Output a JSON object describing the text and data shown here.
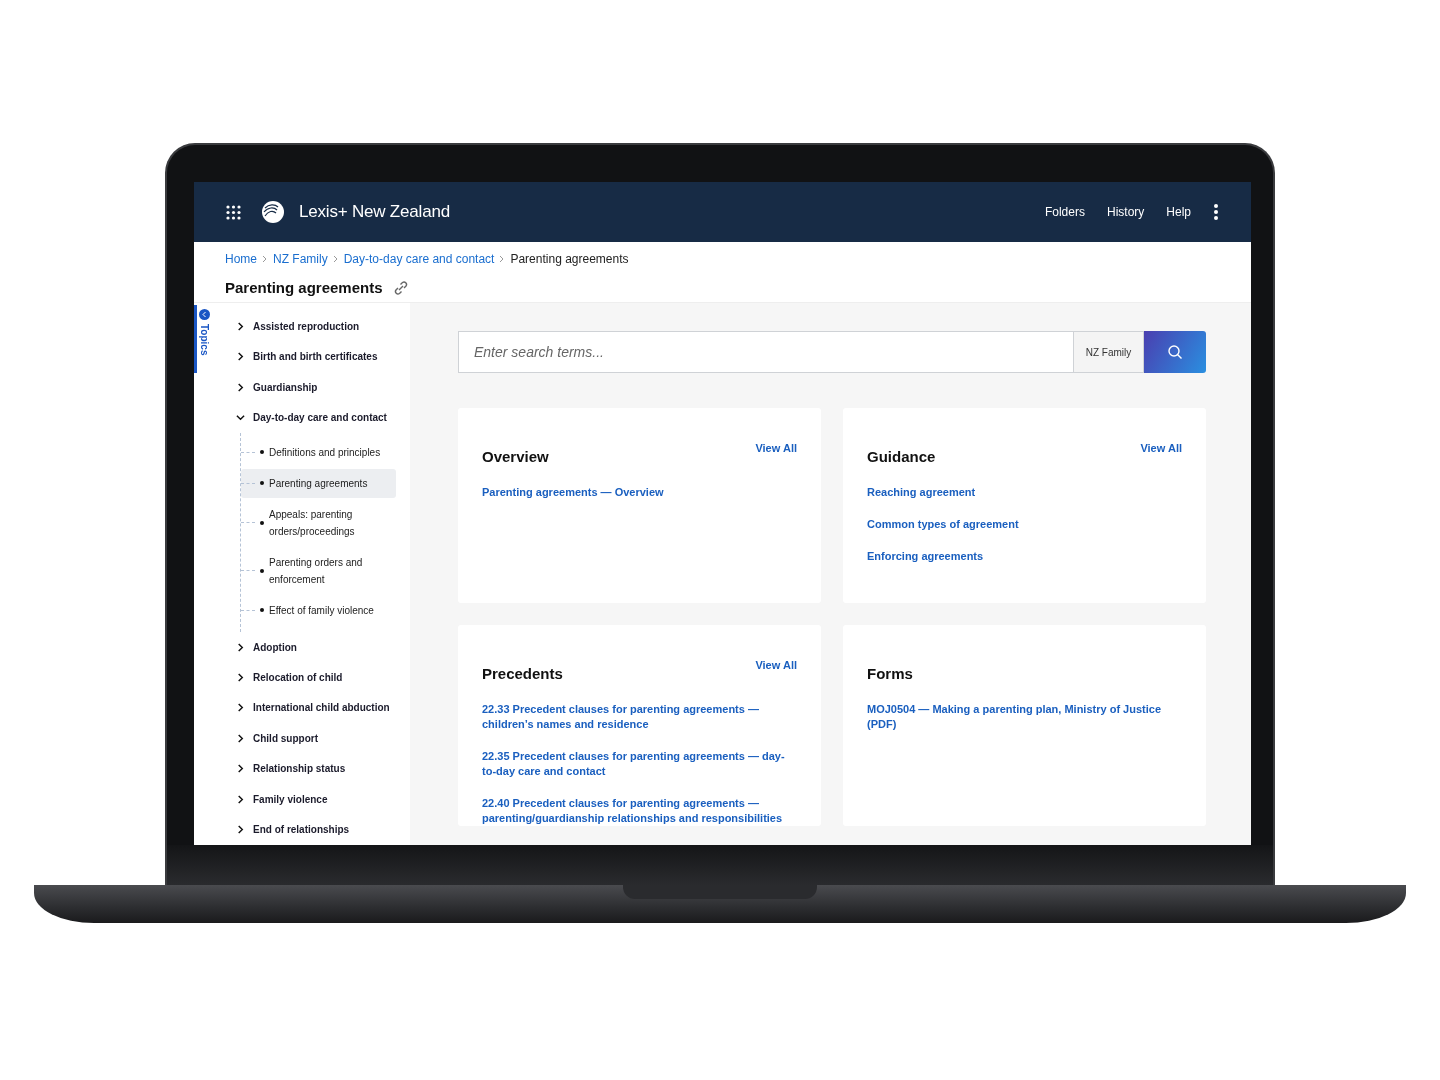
{
  "header": {
    "brand": "Lexis+ New Zealand",
    "nav": [
      "Folders",
      "History",
      "Help"
    ]
  },
  "breadcrumbs": [
    {
      "label": "Home",
      "link": true
    },
    {
      "label": "NZ Family",
      "link": true
    },
    {
      "label": "Day-to-day care and contact",
      "link": true
    },
    {
      "label": "Parenting agreements",
      "link": false
    }
  ],
  "page_title": "Parenting agreements",
  "rail": {
    "label": "Topics"
  },
  "sidebar": {
    "items": [
      {
        "label": "Assisted reproduction",
        "expanded": false
      },
      {
        "label": "Birth and birth certificates",
        "expanded": false
      },
      {
        "label": "Guardianship",
        "expanded": false
      },
      {
        "label": "Day-to-day care and contact",
        "expanded": true,
        "children": [
          {
            "label": "Definitions and principles",
            "selected": false
          },
          {
            "label": "Parenting agreements",
            "selected": true
          },
          {
            "label": "Appeals: parenting orders/proceedings",
            "selected": false
          },
          {
            "label": "Parenting orders and enforcement",
            "selected": false
          },
          {
            "label": "Effect of family violence",
            "selected": false
          }
        ]
      },
      {
        "label": "Adoption",
        "expanded": false
      },
      {
        "label": "Relocation of child",
        "expanded": false
      },
      {
        "label": "International child abduction",
        "expanded": false
      },
      {
        "label": "Child support",
        "expanded": false
      },
      {
        "label": "Relationship status",
        "expanded": false
      },
      {
        "label": "Family violence",
        "expanded": false
      },
      {
        "label": "End of relationships",
        "expanded": false
      }
    ]
  },
  "search": {
    "placeholder": "Enter search terms...",
    "scope": "NZ Family"
  },
  "cards": [
    {
      "title": "Overview",
      "view_all": "View All",
      "links": [
        "Parenting agreements — Overview"
      ]
    },
    {
      "title": "Guidance",
      "view_all": "View All",
      "links": [
        "Reaching agreement",
        "Common types of agreement",
        "Enforcing agreements"
      ]
    },
    {
      "title": "Precedents",
      "view_all": "View All",
      "links": [
        "22.33 Precedent clauses for parenting agreements — children’s names and residence",
        "22.35 Precedent clauses for parenting agreements — day-to-day care and contact",
        "22.40 Precedent clauses for parenting agreements — parenting/guardianship relationships and responsibilities"
      ]
    },
    {
      "title": "Forms",
      "links": [
        "MOJ0504 — Making a parenting plan, Ministry of Justice (PDF)"
      ]
    }
  ]
}
